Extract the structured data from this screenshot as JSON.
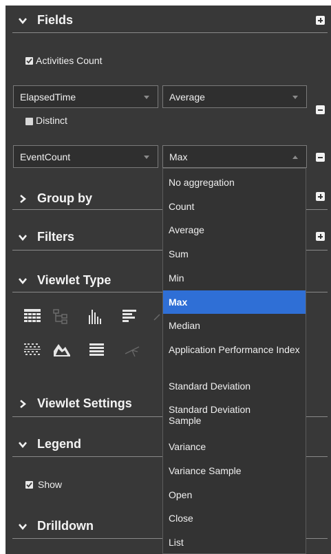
{
  "sections": {
    "fields": "Fields",
    "group_by": "Group by",
    "filters": "Filters",
    "viewlet_type": "Viewlet Type",
    "viewlet_settings": "Viewlet Settings",
    "legend": "Legend",
    "drilldown": "Drilldown"
  },
  "fields": {
    "activities_count": {
      "label": "Activities Count",
      "checked": true
    },
    "rows": [
      {
        "field": "ElapsedTime",
        "aggregation": "Average",
        "distinct_label": "Distinct",
        "distinct_checked": false
      },
      {
        "field": "EventCount",
        "aggregation": "Max"
      }
    ]
  },
  "legend": {
    "show_label": "Show",
    "show_checked": true
  },
  "aggregation_dropdown": {
    "options": [
      "No aggregation",
      "Count",
      "Average",
      "Sum",
      "Min",
      "Max",
      "Median",
      "Application Performance Index",
      "Standard Deviation",
      "Standard Deviation Sample",
      "Variance",
      "Variance Sample",
      "Open",
      "Close",
      "List"
    ],
    "selected": "Max"
  },
  "viewlet_type_icons": [
    "grid-table-icon",
    "tree-icon",
    "bar-chart-icon",
    "horizontal-bar-icon",
    "scatter-table-icon",
    "area-chart-icon",
    "list-icon",
    "network-icon"
  ],
  "colors": {
    "panel": "#383838",
    "selected": "#2f6fd6",
    "line": "#8a8a8a"
  }
}
